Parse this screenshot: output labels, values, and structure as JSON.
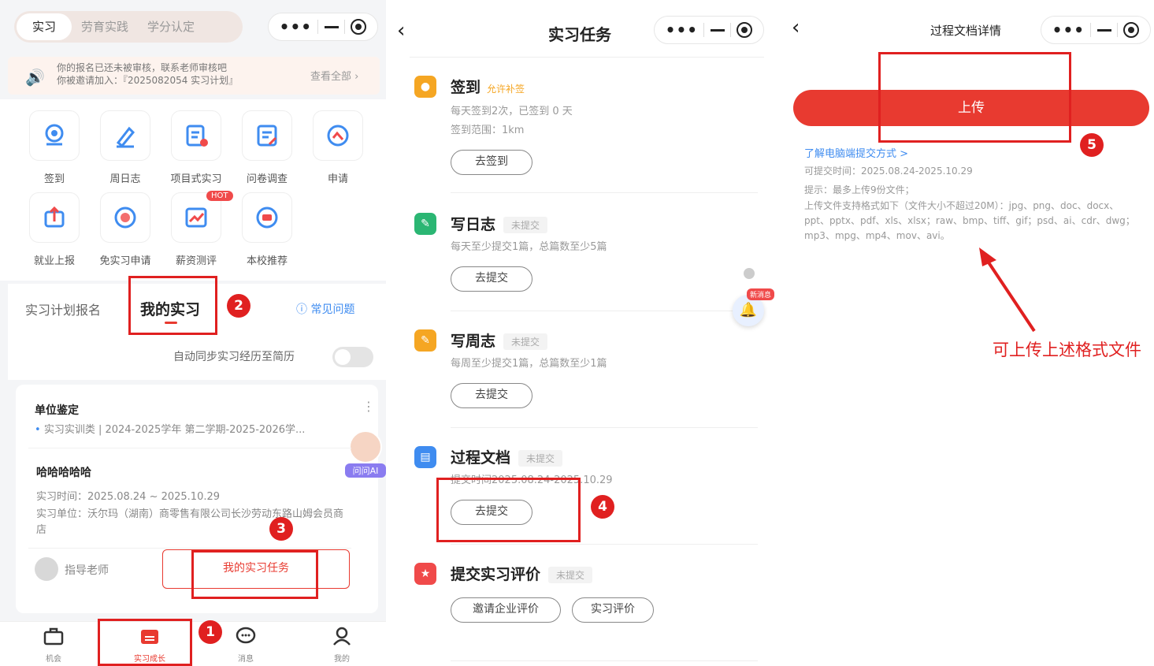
{
  "p1": {
    "seg": [
      "实习",
      "劳育实践",
      "学分认定"
    ],
    "notice": {
      "line1": "你的报名已还未被审核，联系老师审核吧",
      "line2": "你被邀请加入：『2025082054 实习计划』",
      "more": "查看全部 ›"
    },
    "grid": [
      "签到",
      "周日志",
      "项目式实习",
      "问卷调查",
      "申请",
      "就业上报",
      "免实习申请",
      "薪资测评",
      "本校推荐"
    ],
    "hot": "HOT",
    "tabs": [
      "实习计划报名",
      "我的实习"
    ],
    "faq": "常见问题",
    "sync": "自动同步实习经历至简历",
    "unit": {
      "title": "单位鉴定",
      "sub": "实习实训类 | 2024-2025学年 第二学期-2025-2026学..."
    },
    "ai": "问问AI",
    "intern": {
      "name": "哈哈哈哈哈",
      "time": "实习时间：2025.08.24 ~ 2025.10.29",
      "company": "实习单位：沃尔玛（湖南）商零售有限公司长沙劳动东路山姆会员商店",
      "teacher": "指导老师",
      "task_button": "我的实习任务"
    },
    "tabbar": [
      "机会",
      "实习成长",
      "消息",
      "我的"
    ]
  },
  "p2": {
    "title": "实习任务",
    "tasks": [
      {
        "name": "签到",
        "status": "允许补签",
        "line1": "每天签到2次，已签到 0 天",
        "line2": "签到范围：1km",
        "btn": "去签到"
      },
      {
        "name": "写日志",
        "status": "未提交",
        "line1": "每天至少提交1篇，总篇数至少5篇",
        "btn": "去提交"
      },
      {
        "name": "写周志",
        "status": "未提交",
        "line1": "每周至少提交1篇，总篇数至少1篇",
        "btn": "去提交"
      },
      {
        "name": "过程文档",
        "status": "未提交",
        "line1": "提交时间2025.08.24-2025.10.29",
        "btn": "去提交"
      },
      {
        "name": "提交实习评价",
        "status": "未提交",
        "btn1": "邀请企业评价",
        "btn2": "实习评价"
      }
    ],
    "newmsg": "新消息"
  },
  "p3": {
    "title": "过程文档详情",
    "upload": "上传",
    "link": "了解电脑端提交方式 >",
    "time": "可提交时间：2025.08.24-2025.10.29",
    "tip": "提示：最多上传9份文件；",
    "formats": "上传文件支持格式如下（文件大小不超过20M）：jpg、png、doc、docx、ppt、pptx、pdf、xls、xlsx；raw、bmp、tiff、gif；psd、ai、cdr、dwg；mp3、mpg、mp4、mov、avi。",
    "annotation": "可上传上述格式文件"
  },
  "badges": [
    "1",
    "2",
    "3",
    "4",
    "5"
  ],
  "colors": {
    "accent": "#e83a30",
    "annotation": "#e02020",
    "orange": "#f5a623",
    "green": "#2bb673",
    "blue": "#3f8cf0",
    "red": "#f04a4a"
  }
}
